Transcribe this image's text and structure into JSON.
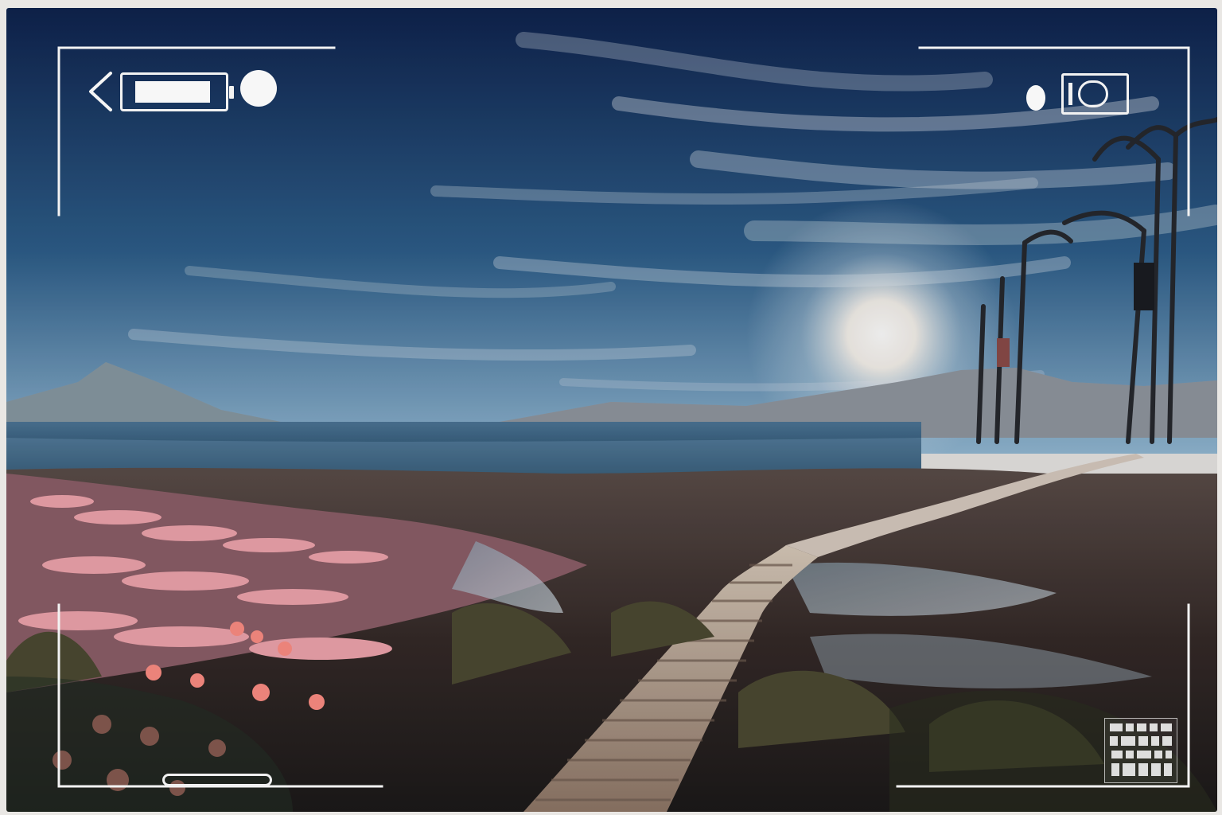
{
  "scene": {
    "label": "",
    "sky_colors": [
      "#0d2149",
      "#2e5f8b",
      "#9fc2d9"
    ],
    "sun_color": "#ffffff",
    "sea_color": "#2d5f82",
    "flower_color": "#f1a2a8",
    "boardwalk_color": "#b49f8e",
    "grass_color": "#6d6a45"
  },
  "hud": {
    "back_icon": "chevron-left-icon",
    "battery_icon": "battery-icon",
    "record_icon": "record-dot-icon",
    "qr_icon": "stamp-icon",
    "corner_bracket_icon": "viewfinder-bracket-icon"
  }
}
